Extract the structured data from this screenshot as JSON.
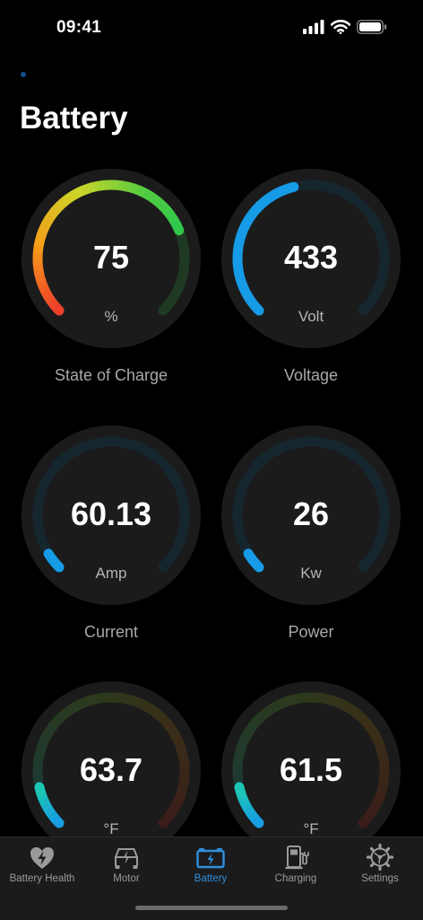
{
  "status": {
    "time": "09:41"
  },
  "page": {
    "title": "Battery"
  },
  "gauges": [
    {
      "value": "75",
      "unit": "%",
      "caption": "State of Charge",
      "fraction": 0.75,
      "style": "rainbow"
    },
    {
      "value": "433",
      "unit": "Volt",
      "caption": "Voltage",
      "fraction": 0.45,
      "style": "blue"
    },
    {
      "value": "60.13",
      "unit": "Amp",
      "caption": "Current",
      "fraction": 0.05,
      "style": "blue"
    },
    {
      "value": "26",
      "unit": "Kw",
      "caption": "Power",
      "fraction": 0.05,
      "style": "blue"
    },
    {
      "value": "63.7",
      "unit": "°F",
      "caption": "",
      "fraction": 0.12,
      "style": "temp"
    },
    {
      "value": "61.5",
      "unit": "°F",
      "caption": "",
      "fraction": 0.12,
      "style": "temp"
    }
  ],
  "tabs": [
    {
      "label": "Battery Health",
      "icon": "heart-bolt-icon",
      "active": false
    },
    {
      "label": "Motor",
      "icon": "car-bolt-icon",
      "active": false
    },
    {
      "label": "Battery",
      "icon": "battery-bolt-icon",
      "active": true
    },
    {
      "label": "Charging",
      "icon": "charging-station-icon",
      "active": false
    },
    {
      "label": "Settings",
      "icon": "gear-icon",
      "active": false
    }
  ],
  "colors": {
    "accent": "#2f8fdd",
    "gauge_blue": "#169be6",
    "gauge_track_blue": "#16262f",
    "gauge_bg": "#1b1b1c",
    "green": "#30c84a",
    "orange": "#f5a019",
    "red": "#ee3b2a",
    "teal": "#1ec9b0"
  }
}
